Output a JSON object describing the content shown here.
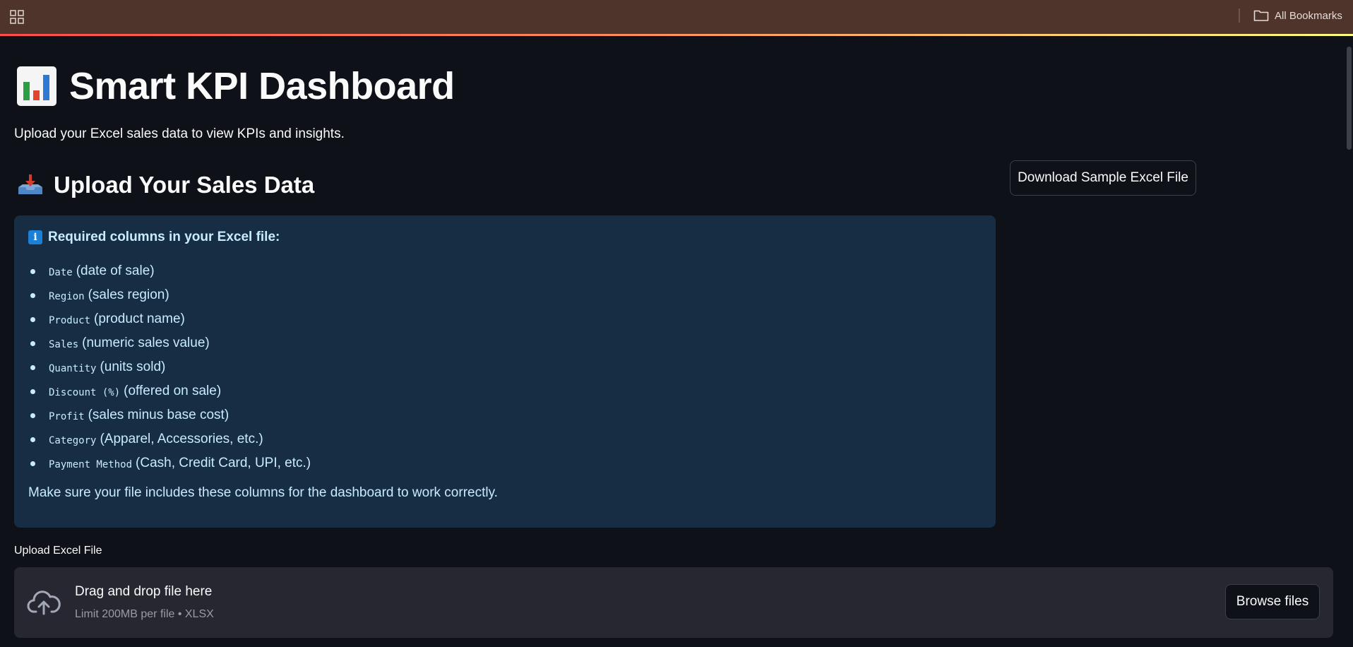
{
  "browser": {
    "bookmarks_label": "All Bookmarks",
    "bar_color": "#4e342a"
  },
  "page": {
    "title": "Smart KPI Dashboard",
    "title_icon": "bar-chart-emoji",
    "subtitle": "Upload your Excel sales data to view KPIs and insights.",
    "section_heading": "Upload Your Sales Data",
    "section_icon": "inbox-tray-emoji",
    "download_button": "Download Sample Excel File"
  },
  "info": {
    "heading": "Required columns in your Excel file:",
    "columns": [
      {
        "code": "Date",
        "desc": "(date of sale)"
      },
      {
        "code": "Region",
        "desc": "(sales region)"
      },
      {
        "code": "Product",
        "desc": "(product name)"
      },
      {
        "code": "Sales",
        "desc": "(numeric sales value)"
      },
      {
        "code": "Quantity",
        "desc": "(units sold)"
      },
      {
        "code": "Discount (%)",
        "desc": "(offered on sale)"
      },
      {
        "code": "Profit",
        "desc": "(sales minus base cost)"
      },
      {
        "code": "Category",
        "desc": "(Apparel, Accessories, etc.)"
      },
      {
        "code": "Payment Method",
        "desc": "(Cash, Credit Card, UPI, etc.)"
      }
    ],
    "footer": "Make sure your file includes these columns for the dashboard to work correctly.",
    "background_color": "#172d43",
    "text_color": "#c7ebff"
  },
  "uploader": {
    "label": "Upload Excel File",
    "drop_text": "Drag and drop file here",
    "limit_text": "Limit 200MB per file • XLSX",
    "browse_button": "Browse files"
  },
  "theme": {
    "background": "#0e1117",
    "accent_gradient": [
      "#ff4b4b",
      "#fffd80"
    ]
  }
}
